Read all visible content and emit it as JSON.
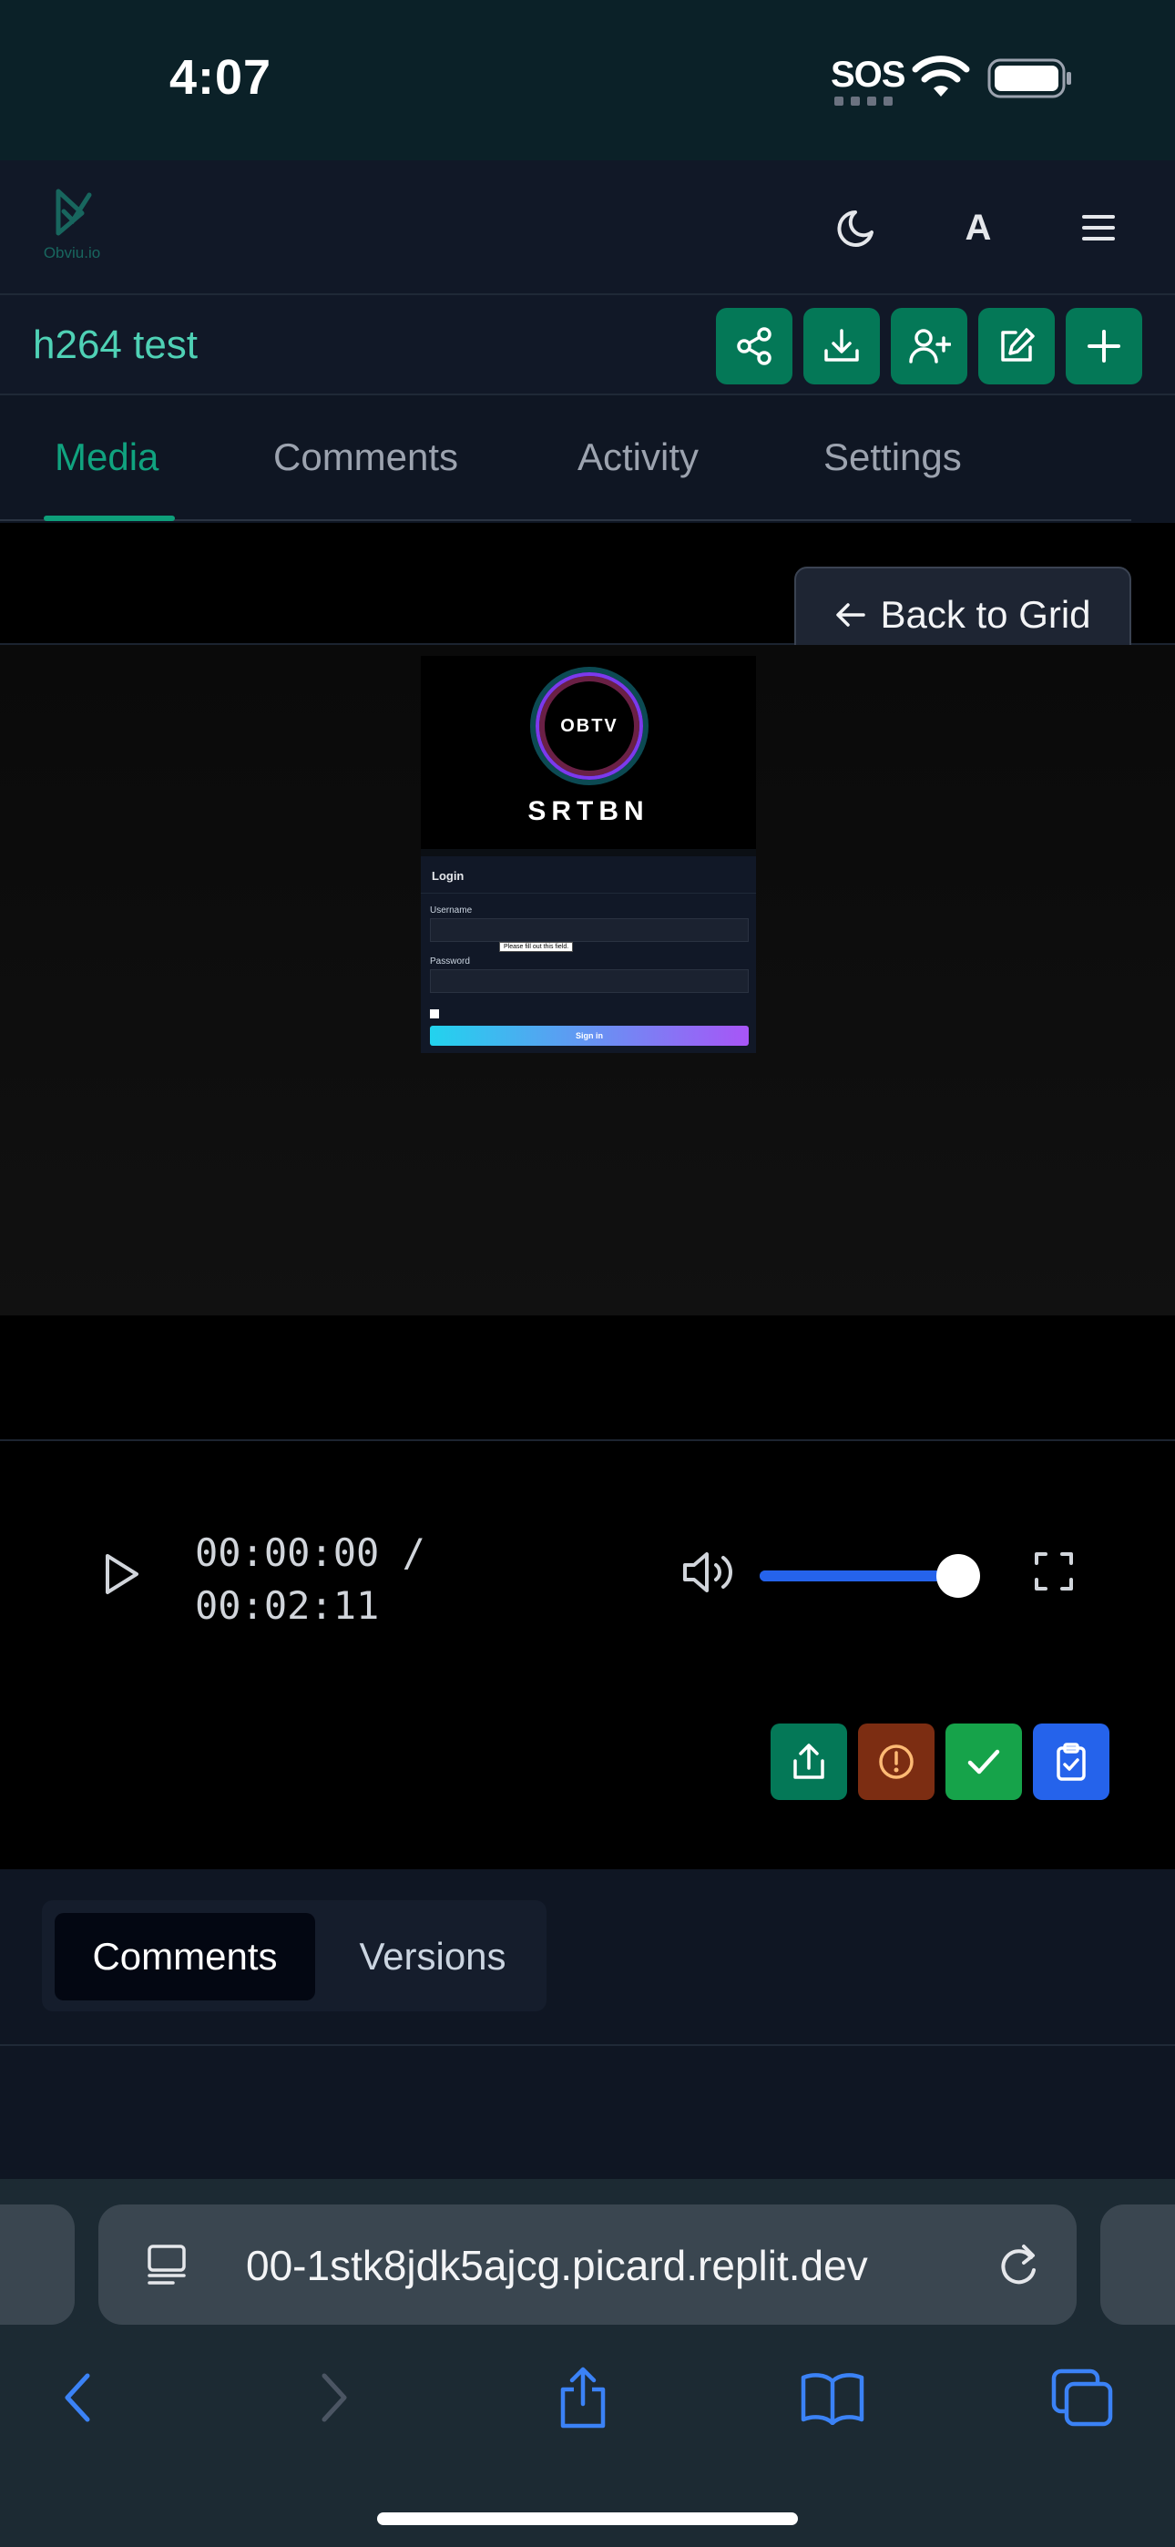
{
  "status_bar": {
    "time": "4:07",
    "sos": "SOS"
  },
  "app": {
    "logo_text": "Obviu.io",
    "lang_label": "A"
  },
  "project": {
    "title": "h264 test"
  },
  "tabs": [
    {
      "label": "Media",
      "active": true
    },
    {
      "label": "Comments",
      "active": false
    },
    {
      "label": "Activity",
      "active": false
    },
    {
      "label": "Settings",
      "active": false
    }
  ],
  "viewer": {
    "back_label": "Back to Grid",
    "preview": {
      "orb_text": "OBTV",
      "brand": "SRTBN",
      "login_title": "Login",
      "username_label": "Username",
      "password_label": "Password",
      "tooltip": "Please fill out this field.",
      "signin_label": "Sign in"
    }
  },
  "player": {
    "current_time": "00:00:00 /",
    "duration": "00:02:11",
    "volume": 1.0
  },
  "panel": {
    "segments": [
      "Comments",
      "Versions"
    ],
    "active_segment": "Comments"
  },
  "browser": {
    "url": "00-1stk8jdk5ajcg.picard.replit.dev"
  },
  "colors": {
    "accent": "#047857",
    "tab_active": "#10a37f",
    "title": "#4fd1b5",
    "warn": "#7c2d12",
    "approve": "#16a34a",
    "review": "#2563eb"
  }
}
